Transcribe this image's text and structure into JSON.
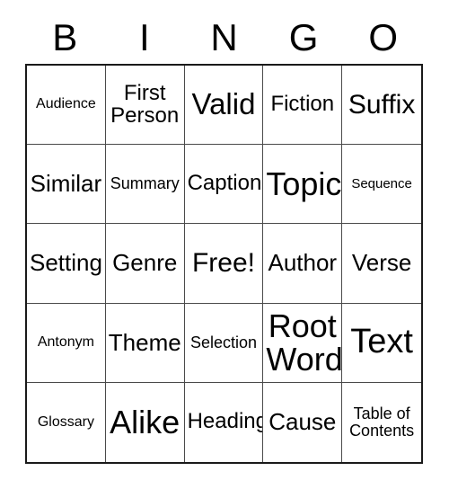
{
  "card": {
    "header": {
      "letters": [
        "B",
        "I",
        "N",
        "G",
        "O"
      ]
    },
    "grid": {
      "rows": 5,
      "columns": 5,
      "cells": [
        [
          {
            "label": "Audience",
            "size": "sz-s"
          },
          {
            "label": "First\nPerson",
            "size": "sz-m"
          },
          {
            "label": "Valid",
            "size": "sz-xl"
          },
          {
            "label": "Fiction",
            "size": "sz-m"
          },
          {
            "label": "Suffix",
            "size": "sz-l"
          }
        ],
        [
          {
            "label": "Similar",
            "size": "sz-ml"
          },
          {
            "label": "Summary",
            "size": "sz-sm"
          },
          {
            "label": "Caption",
            "size": "sz-m"
          },
          {
            "label": "Topic",
            "size": "sz-xxl"
          },
          {
            "label": "Sequence",
            "size": "sz-xs"
          }
        ],
        [
          {
            "label": "Setting",
            "size": "sz-ml"
          },
          {
            "label": "Genre",
            "size": "sz-ml"
          },
          {
            "label": "Free!",
            "size": "sz-l"
          },
          {
            "label": "Author",
            "size": "sz-ml"
          },
          {
            "label": "Verse",
            "size": "sz-ml"
          }
        ],
        [
          {
            "label": "Antonym",
            "size": "sz-s"
          },
          {
            "label": "Theme",
            "size": "sz-ml"
          },
          {
            "label": "Selection",
            "size": "sz-sm"
          },
          {
            "label": "Root\nWord",
            "size": "sz-xxl"
          },
          {
            "label": "Text",
            "size": "sz-xxxl"
          }
        ],
        [
          {
            "label": "Glossary",
            "size": "sz-s"
          },
          {
            "label": "Alike",
            "size": "sz-xxl"
          },
          {
            "label": "Heading",
            "size": "sz-m"
          },
          {
            "label": "Cause",
            "size": "sz-ml"
          },
          {
            "label": "Table of\nContents",
            "size": "sz-sm"
          }
        ]
      ]
    },
    "colors": {
      "background": "#ffffff",
      "text": "#000000",
      "outer_border": "#1a1a1a",
      "inner_border": "#4a4a4a"
    }
  }
}
